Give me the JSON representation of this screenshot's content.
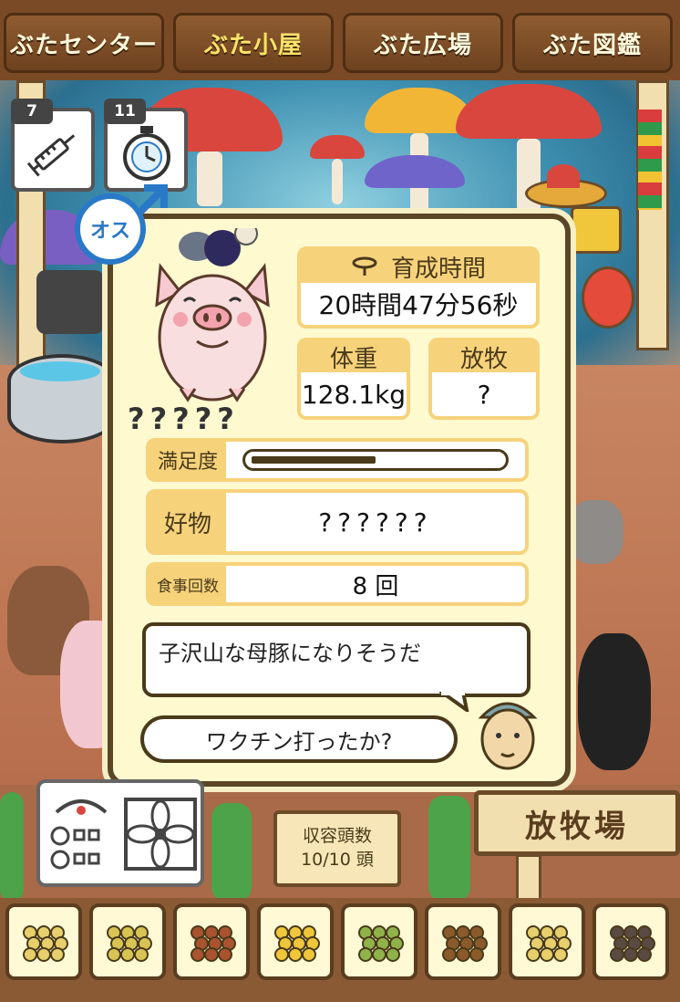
{
  "nav": {
    "tabs": [
      {
        "label": "ぶたセンター",
        "active": false
      },
      {
        "label": "ぶた小屋",
        "active": true
      },
      {
        "label": "ぶた広場",
        "active": false
      },
      {
        "label": "ぶた図鑑",
        "active": false
      }
    ]
  },
  "items": {
    "syringe_count": "7",
    "stopwatch_count": "11"
  },
  "pig": {
    "gender_label": "オス",
    "name": "?????"
  },
  "stats": {
    "raising_time_label": "育成時間",
    "raising_time_value": "20時間47分56秒",
    "weight_label": "体重",
    "weight_value": "128.1kg",
    "grazing_label": "放牧",
    "grazing_value": "?",
    "satisfaction_label": "満足度",
    "satisfaction_level": 0.5,
    "favorite_label": "好物",
    "favorite_value": "??????",
    "meals_label": "食事回数",
    "meals_value": "8 回"
  },
  "dialogue": {
    "comment": "子沢山な母豚になりそうだ",
    "question": "ワクチン打ったか?"
  },
  "bottom": {
    "capacity_label": "収容頭数",
    "capacity_value": "10/10 頭",
    "ranch_label": "放牧場"
  },
  "food_slots": [
    "feed-pellets-icon",
    "feed-grains-icon",
    "sweet-potato-icon",
    "corn-icon",
    "beans-icon",
    "acorn-icon",
    "feed-bowl-icon",
    "truffle-icon"
  ],
  "colors": {
    "card_bg": "#fff9d0",
    "label_yellow": "#f6d27b",
    "male_blue": "#2a79c8",
    "nav_brown": "#7a4a27"
  }
}
